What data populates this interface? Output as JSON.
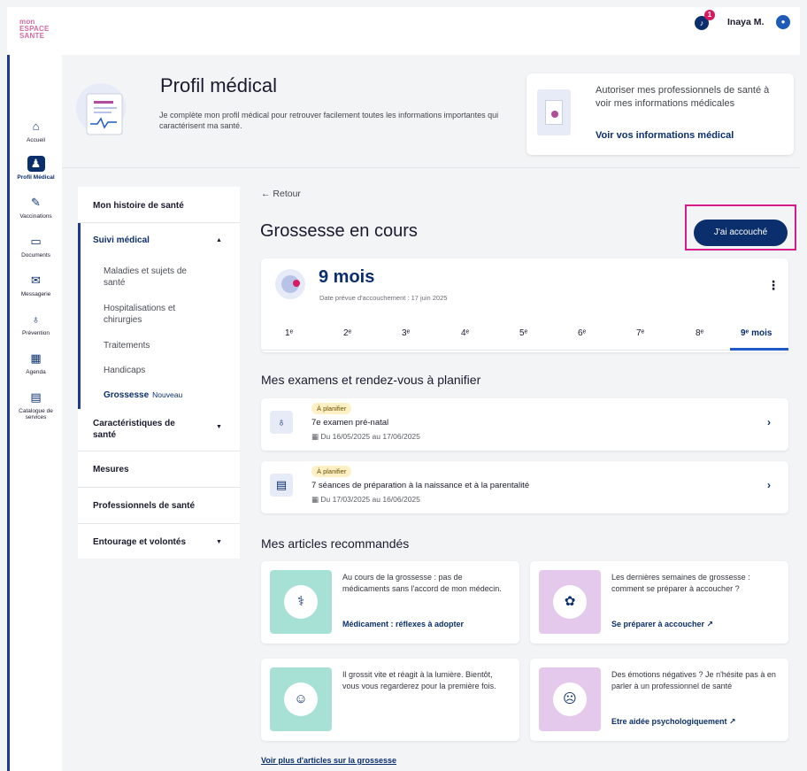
{
  "header": {
    "logo_lines": [
      "mon",
      "ESPACE",
      "SANTE"
    ],
    "notifications_count": "1",
    "user_name": "Inaya M."
  },
  "left_nav": [
    {
      "label": "Accueil",
      "icon": "home-icon",
      "glyph": "⌂"
    },
    {
      "label": "Profil Médical",
      "icon": "profile-icon",
      "glyph": "♟"
    },
    {
      "label": "Vaccinations",
      "icon": "syringe-icon",
      "glyph": "✎"
    },
    {
      "label": "Documents",
      "icon": "folder-icon",
      "glyph": "▭"
    },
    {
      "label": "Messagerie",
      "icon": "mail-icon",
      "glyph": "✉"
    },
    {
      "label": "Prévention",
      "icon": "stethoscope-icon",
      "glyph": "♁"
    },
    {
      "label": "Agenda",
      "icon": "calendar-icon",
      "glyph": "▦"
    },
    {
      "label": "Catalogue de services",
      "icon": "grid-icon",
      "glyph": "▤"
    }
  ],
  "profile": {
    "title": "Profil médical",
    "description": "Je complète mon profil médical pour retrouver facilement toutes les informations importantes qui caractérisent ma santé."
  },
  "auth_card": {
    "text": "Autoriser mes professionnels de santé à voir mes informations médicales",
    "link": "Voir vos informations médical"
  },
  "subnav": {
    "history": "Mon histoire de santé",
    "followup": "Suivi médical",
    "children": [
      "Maladies et sujets de santé",
      "Hospitalisations et chirurgies",
      "Traitements",
      "Handicaps"
    ],
    "pregnancy": "Grossesse",
    "pregnancy_badge": "Nouveau",
    "characteristics": "Caractéristiques de santé",
    "measures": "Mesures",
    "professionals": "Professionnels de santé",
    "entourage": "Entourage et volontés"
  },
  "main": {
    "back": "← Retour",
    "title": "Grossesse en cours",
    "born_button": "J'ai accouché",
    "months": "9 mois",
    "due_date": "Date prévue d'accouchement : 17 juin 2025",
    "month_tabs": [
      "1ᵉ",
      "2ᵉ",
      "3ᵉ",
      "4ᵉ",
      "5ᵉ",
      "6ᵉ",
      "7ᵉ",
      "8ᵉ",
      "9ᵉ mois"
    ],
    "selected_tab": 8
  },
  "exams": {
    "heading": "Mes examens et rendez-vous à planifier",
    "items": [
      {
        "badge": "À planifier",
        "title": "7e examen pré-natal",
        "date": "▦ Du 16/05/2025 au 17/06/2025",
        "icon": "stethoscope-icon",
        "glyph": "♁"
      },
      {
        "badge": "À planifier",
        "title": "7 séances de préparation à la naissance et à la parentalité",
        "date": "▦ Du 17/03/2025 au 16/06/2025",
        "icon": "clipboard-icon",
        "glyph": "▤"
      }
    ]
  },
  "articles": {
    "heading": "Mes articles recommandés",
    "items": [
      {
        "text": "Au cours de la grossesse : pas de médicaments sans l'accord de mon médecin.",
        "link": "Médicament : réflexes à adopter",
        "color": "teal",
        "icon": "pills-icon",
        "glyph": "⚕"
      },
      {
        "text": "Les dernières semaines de grossesse : comment se préparer à accoucher ?",
        "link": "Se préparer à accoucher ↗",
        "color": "lilac",
        "icon": "lotus-icon",
        "glyph": "✿"
      },
      {
        "text": "Il grossit vite et réagit à la lumière. Bientôt, vous vous regarderez pour la première fois.",
        "link": "",
        "color": "teal",
        "icon": "baby-icon",
        "glyph": "☺"
      },
      {
        "text": "Des émotions négatives ? Je n'hésite pas à en parler à un professionnel de santé",
        "link": "Etre aidée psychologiquement ↗",
        "color": "lilac",
        "icon": "head-icon",
        "glyph": "☹"
      }
    ],
    "more": "Voir plus d'articles sur la grossesse"
  }
}
